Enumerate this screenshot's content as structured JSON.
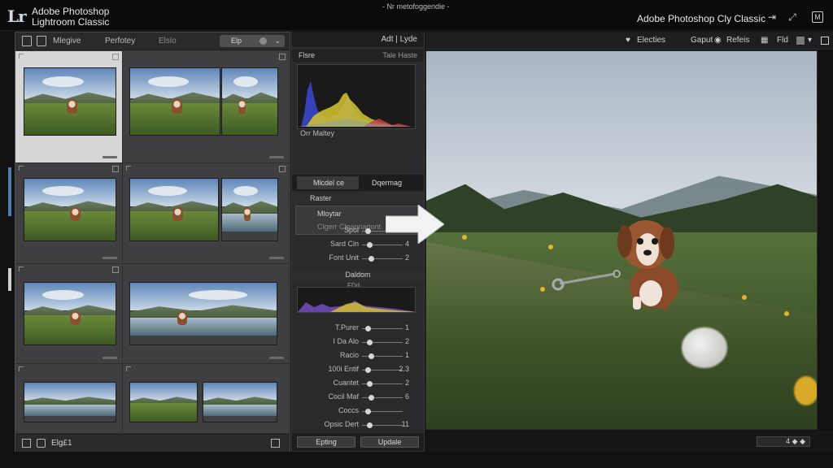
{
  "titlebar": {
    "logo": "Lr",
    "app_line1": "Adobe Photoshop",
    "app_line2": "Lightroom Classic",
    "doc_title": "- Nr metofoggendie -",
    "right_title": "Adobe Photoshop Cly Classic",
    "icons": [
      "tab-icon",
      "expand-icon",
      "grid-icon",
      "m-icon"
    ]
  },
  "left_panel": {
    "toolbar": {
      "tab1": "Mlegive",
      "tab2": "Perfotey",
      "tab3": "Elslo",
      "select_label": "Elp"
    },
    "bottom_label": "Elg£1"
  },
  "mid_panel": {
    "header": "Adt | Lyde",
    "section1": {
      "title": "Flsre",
      "right": "Tale Haste"
    },
    "histogram_label": "Orr Maltey",
    "tabs": {
      "tab1": "Mlcdel ce",
      "tab2": "Dqermag"
    },
    "sub_section": {
      "title": "Raster",
      "item1": "Mloytar",
      "item2": "Clgerr Clgannagont"
    },
    "sliders_a": [
      {
        "label": "Spol",
        "value": "1"
      },
      {
        "label": "Sard Cin",
        "value": "4"
      },
      {
        "label": "Font Unit",
        "value": "2"
      }
    ],
    "section2": {
      "title": "Daldom",
      "sublabel": "FDd"
    },
    "sliders_b": [
      {
        "label": "T.Purer",
        "value": "1"
      },
      {
        "label": "I Da Alo",
        "value": "2"
      },
      {
        "label": "Racio",
        "value": "1"
      },
      {
        "label": "100i Entif",
        "value": "2.3"
      },
      {
        "label": "Cuantet",
        "value": "2"
      },
      {
        "label": "Cocil Maf",
        "value": "6"
      },
      {
        "label": "Coccs",
        "value": ""
      },
      {
        "label": "Opsic Dert",
        "value": "11"
      }
    ],
    "bottom_btn1": "Epting",
    "bottom_btn2": "Updale"
  },
  "right_panel": {
    "header_items": [
      "Electies",
      "Gaput",
      "Refeis",
      "Fld"
    ],
    "zoom_readout": "4 ◆ ◆"
  }
}
